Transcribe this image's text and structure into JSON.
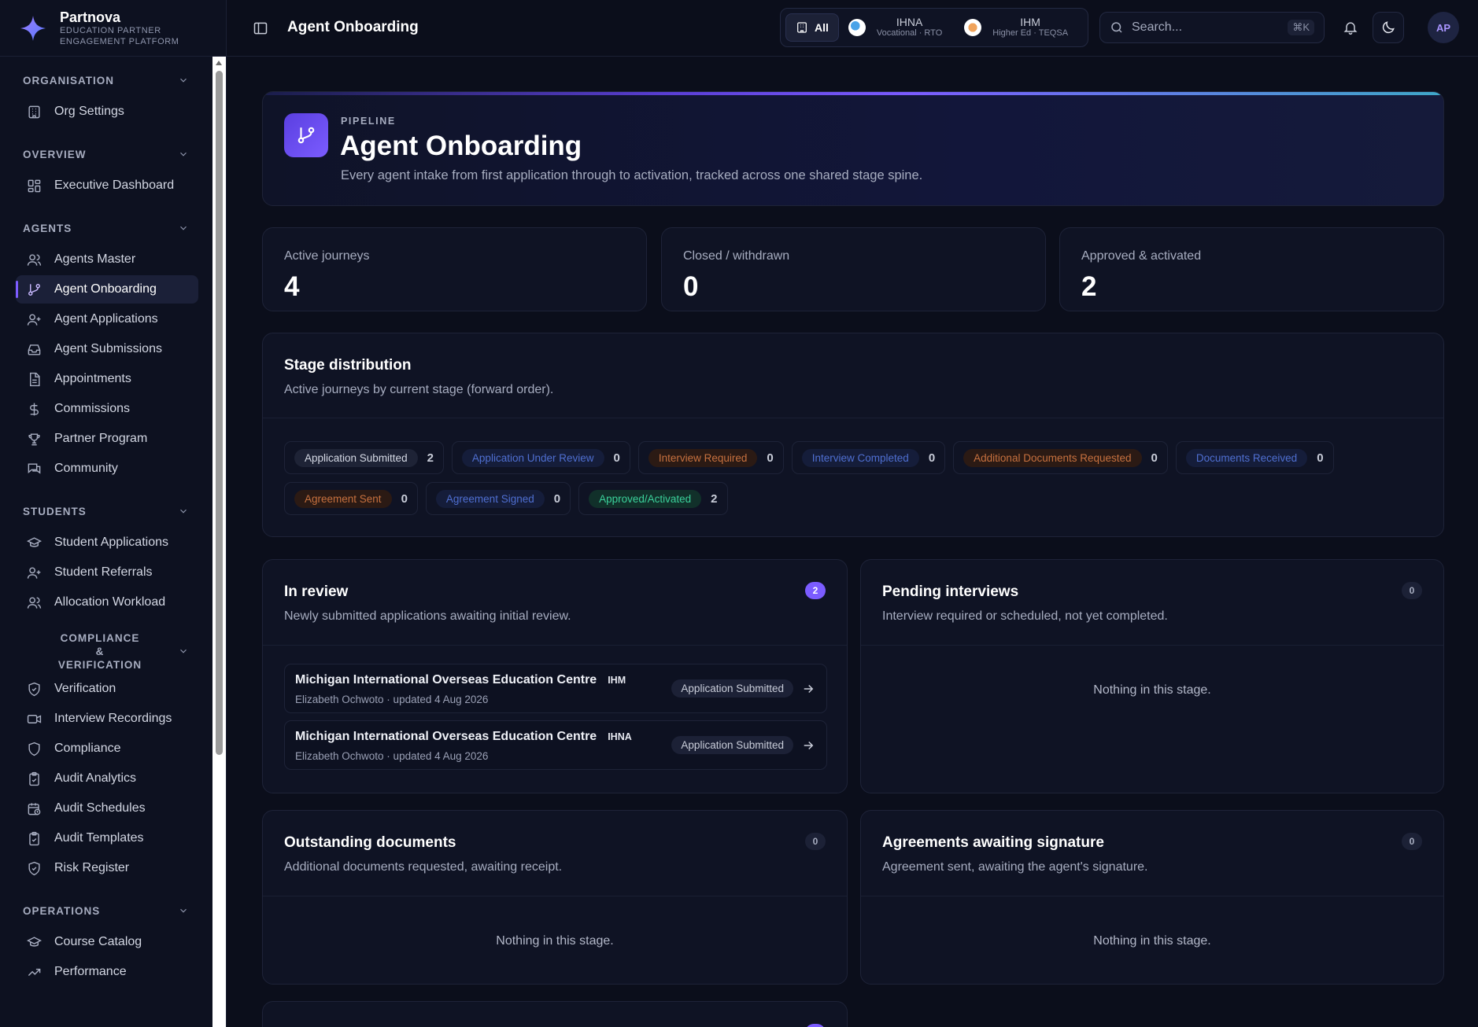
{
  "brand": {
    "name": "Partnova",
    "tagline": "Education Partner Engagement Platform"
  },
  "sidebar": {
    "sections": [
      {
        "title": "ORGANISATION",
        "items": [
          {
            "label": "Org Settings",
            "icon": "building-icon"
          }
        ]
      },
      {
        "title": "OVERVIEW",
        "items": [
          {
            "label": "Executive Dashboard",
            "icon": "dashboard-icon"
          }
        ]
      },
      {
        "title": "AGENTS",
        "items": [
          {
            "label": "Agents Master",
            "icon": "users-icon"
          },
          {
            "label": "Agent Onboarding",
            "icon": "git-branch-icon",
            "active": true
          },
          {
            "label": "Agent Applications",
            "icon": "user-plus-icon"
          },
          {
            "label": "Agent Submissions",
            "icon": "inbox-icon"
          },
          {
            "label": "Appointments",
            "icon": "document-icon"
          },
          {
            "label": "Commissions",
            "icon": "dollar-icon"
          },
          {
            "label": "Partner Program",
            "icon": "trophy-icon"
          },
          {
            "label": "Community",
            "icon": "chat-icon"
          }
        ]
      },
      {
        "title": "STUDENTS",
        "items": [
          {
            "label": "Student Applications",
            "icon": "graduation-cap-icon"
          },
          {
            "label": "Student Referrals",
            "icon": "user-plus-icon"
          },
          {
            "label": "Allocation Workload",
            "icon": "users-icon"
          }
        ]
      },
      {
        "title": "COMPLIANCE & VERIFICATION",
        "items": [
          {
            "label": "Verification",
            "icon": "shield-check-icon"
          },
          {
            "label": "Interview Recordings",
            "icon": "video-icon"
          },
          {
            "label": "Compliance",
            "icon": "shield-icon"
          },
          {
            "label": "Audit Analytics",
            "icon": "clipboard-check-icon"
          },
          {
            "label": "Audit Schedules",
            "icon": "calendar-clock-icon"
          },
          {
            "label": "Audit Templates",
            "icon": "clipboard-check-icon"
          },
          {
            "label": "Risk Register",
            "icon": "shield-check-icon"
          }
        ]
      },
      {
        "title": "OPERATIONS",
        "items": [
          {
            "label": "Course Catalog",
            "icon": "graduation-cap-icon"
          },
          {
            "label": "Performance",
            "icon": "trend-icon"
          }
        ]
      }
    ]
  },
  "topbar": {
    "title": "Agent Onboarding",
    "tenant_all": "All",
    "tenants": [
      {
        "name": "IHNA",
        "sub": "Vocational · RTO"
      },
      {
        "name": "IHM",
        "sub": "Higher Ed · TEQSA"
      }
    ],
    "search_placeholder": "Search...",
    "shortcut": "⌘K",
    "avatar": "AP"
  },
  "hero": {
    "kicker": "PIPELINE",
    "title": "Agent Onboarding",
    "subtitle": "Every agent intake from first application through to activation, tracked across one shared stage spine."
  },
  "stats": [
    {
      "label": "Active journeys",
      "value": "4"
    },
    {
      "label": "Closed / withdrawn",
      "value": "0"
    },
    {
      "label": "Approved & activated",
      "value": "2"
    }
  ],
  "distribution": {
    "title": "Stage distribution",
    "subtitle": "Active journeys by current stage (forward order).",
    "stages": [
      {
        "label": "Application Submitted",
        "count": "2",
        "tone": "neutral"
      },
      {
        "label": "Application Under Review",
        "count": "0",
        "tone": "blue"
      },
      {
        "label": "Interview Required",
        "count": "0",
        "tone": "orange"
      },
      {
        "label": "Interview Completed",
        "count": "0",
        "tone": "blue"
      },
      {
        "label": "Additional Documents Requested",
        "count": "0",
        "tone": "orange"
      },
      {
        "label": "Documents Received",
        "count": "0",
        "tone": "blue"
      },
      {
        "label": "Agreement Sent",
        "count": "0",
        "tone": "orange"
      },
      {
        "label": "Agreement Signed",
        "count": "0",
        "tone": "blue"
      },
      {
        "label": "Approved/Activated",
        "count": "2",
        "tone": "green"
      }
    ]
  },
  "panels": {
    "in_review": {
      "title": "In review",
      "subtitle": "Newly submitted applications awaiting initial review.",
      "count": "2",
      "rows": [
        {
          "org": "Michigan International Overseas Education Centre",
          "tag": "IHM",
          "meta": "Elizabeth Ochwoto · updated 4 Aug 2026",
          "status": "Application Submitted"
        },
        {
          "org": "Michigan International Overseas Education Centre",
          "tag": "IHNA",
          "meta": "Elizabeth Ochwoto · updated 4 Aug 2026",
          "status": "Application Submitted"
        }
      ]
    },
    "pending_interviews": {
      "title": "Pending interviews",
      "subtitle": "Interview required or scheduled, not yet completed.",
      "count": "0",
      "empty": "Nothing in this stage."
    },
    "outstanding_documents": {
      "title": "Outstanding documents",
      "subtitle": "Additional documents requested, awaiting receipt.",
      "count": "0",
      "empty": "Nothing in this stage."
    },
    "agreements": {
      "title": "Agreements awaiting signature",
      "subtitle": "Agreement sent, awaiting the agent's signature.",
      "count": "0",
      "empty": "Nothing in this stage."
    }
  },
  "colors": {
    "accent": "#7b5cff",
    "background": "#0b0e1b",
    "card": "#0f1324",
    "success": "#3bd19b",
    "warning": "#c7713f",
    "info": "#4f6fd1"
  }
}
